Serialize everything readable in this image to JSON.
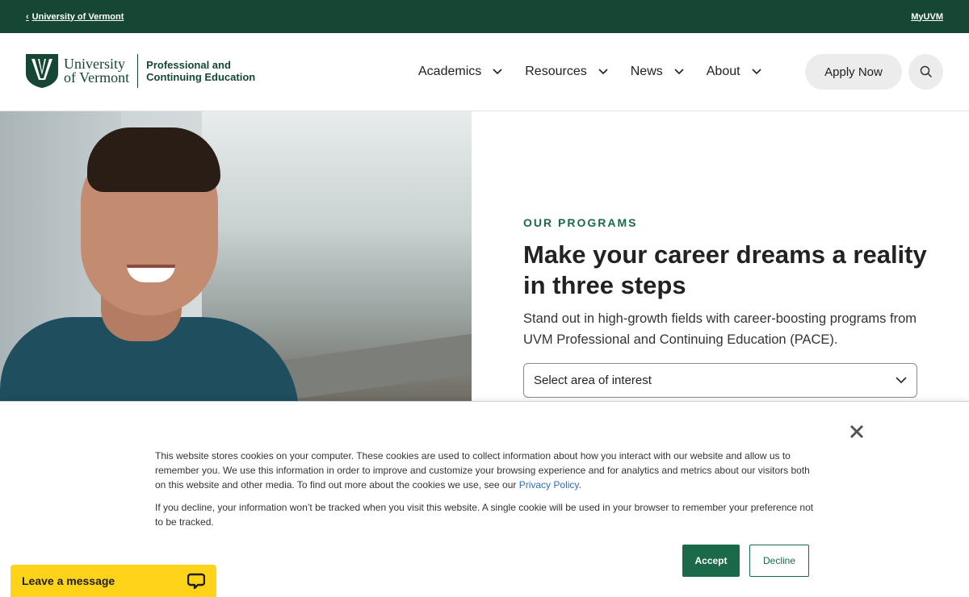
{
  "utility": {
    "back_link": "University of Vermont",
    "myuvm": "MyUVM"
  },
  "logo": {
    "line1": "University",
    "line2": "of Vermont",
    "sub1": "Professional and",
    "sub2": "Continuing Education"
  },
  "nav": {
    "items": [
      {
        "label": "Academics"
      },
      {
        "label": "Resources"
      },
      {
        "label": "News"
      },
      {
        "label": "About"
      }
    ],
    "apply": "Apply Now"
  },
  "hero": {
    "eyebrow": "OUR PROGRAMS",
    "headline": "Make your career dreams a reality in three steps",
    "subtext": "Stand out in high-growth fields with career-boosting programs from UVM Professional and Continuing Education (PACE).",
    "select_value": "Select area of interest"
  },
  "cookie": {
    "para1_before": "This website stores cookies on your computer. These cookies are used to collect information about how you interact with our website and allow us to remember you. We use this information in order to improve and customize your browsing experience and for analytics and metrics about our visitors both on this website and other media. To find out more about the cookies we use, see our ",
    "privacy_link": "Privacy Policy",
    "para1_after": ".",
    "para2": "If you decline, your information won’t be tracked when you visit this website. A single cookie will be used in your browser to remember your preference not to be tracked.",
    "accept": "Accept",
    "decline": "Decline"
  },
  "chat": {
    "label": "Leave a message"
  },
  "colors": {
    "brand_green": "#154734",
    "accent_green": "#1a6a4a",
    "chat_yellow": "#ffd31a"
  }
}
